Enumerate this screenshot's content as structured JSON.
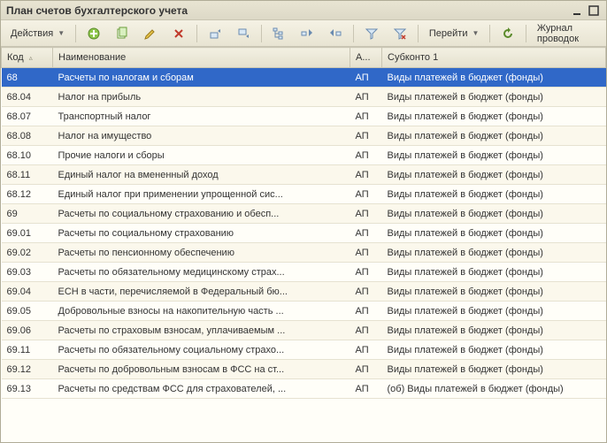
{
  "titlebar": {
    "title": "План счетов бухгалтерского учета"
  },
  "toolbar": {
    "actions_label": "Действия",
    "goto_label": "Перейти",
    "journal_label": "Журнал проводок"
  },
  "grid": {
    "headers": {
      "code": "Код",
      "name": "Наименование",
      "ap": "А...",
      "sub": "Субконто 1"
    },
    "rows": [
      {
        "code": "68",
        "name": "Расчеты по налогам и сборам",
        "ap": "АП",
        "sub": "Виды платежей в бюджет (фонды)",
        "selected": true
      },
      {
        "code": "68.04",
        "name": "Налог на прибыль",
        "ap": "АП",
        "sub": "Виды платежей в бюджет (фонды)"
      },
      {
        "code": "68.07",
        "name": "Транспортный налог",
        "ap": "АП",
        "sub": "Виды платежей в бюджет (фонды)"
      },
      {
        "code": "68.08",
        "name": "Налог на имущество",
        "ap": "АП",
        "sub": "Виды платежей в бюджет (фонды)"
      },
      {
        "code": "68.10",
        "name": "Прочие налоги и сборы",
        "ap": "АП",
        "sub": "Виды платежей в бюджет (фонды)"
      },
      {
        "code": "68.11",
        "name": "Единый налог на вмененный доход",
        "ap": "АП",
        "sub": "Виды платежей в бюджет (фонды)"
      },
      {
        "code": "68.12",
        "name": "Единый налог при применении упрощенной сис...",
        "ap": "АП",
        "sub": "Виды платежей в бюджет (фонды)"
      },
      {
        "code": "69",
        "name": "Расчеты по социальному страхованию и обесп...",
        "ap": "АП",
        "sub": "Виды платежей в бюджет (фонды)"
      },
      {
        "code": "69.01",
        "name": "Расчеты по социальному страхованию",
        "ap": "АП",
        "sub": "Виды платежей в бюджет (фонды)"
      },
      {
        "code": "69.02",
        "name": "Расчеты по пенсионному обеспечению",
        "ap": "АП",
        "sub": "Виды платежей в бюджет (фонды)"
      },
      {
        "code": "69.03",
        "name": "Расчеты по обязательному медицинскому страх...",
        "ap": "АП",
        "sub": "Виды платежей в бюджет (фонды)"
      },
      {
        "code": "69.04",
        "name": "ЕСН в части, перечисляемой в Федеральный бю...",
        "ap": "АП",
        "sub": "Виды платежей в бюджет (фонды)"
      },
      {
        "code": "69.05",
        "name": "Добровольные взносы на накопительную часть ...",
        "ap": "АП",
        "sub": "Виды платежей в бюджет (фонды)"
      },
      {
        "code": "69.06",
        "name": "Расчеты по страховым взносам, уплачиваемым ...",
        "ap": "АП",
        "sub": "Виды платежей в бюджет (фонды)"
      },
      {
        "code": "69.11",
        "name": "Расчеты по обязательному социальному страхо...",
        "ap": "АП",
        "sub": "Виды платежей в бюджет (фонды)"
      },
      {
        "code": "69.12",
        "name": "Расчеты по добровольным взносам в ФСС на ст...",
        "ap": "АП",
        "sub": "Виды платежей в бюджет (фонды)"
      },
      {
        "code": "69.13",
        "name": "Расчеты по средствам ФСС для страхователей, ...",
        "ap": "АП",
        "sub": "(об) Виды платежей в бюджет (фонды)"
      }
    ]
  }
}
